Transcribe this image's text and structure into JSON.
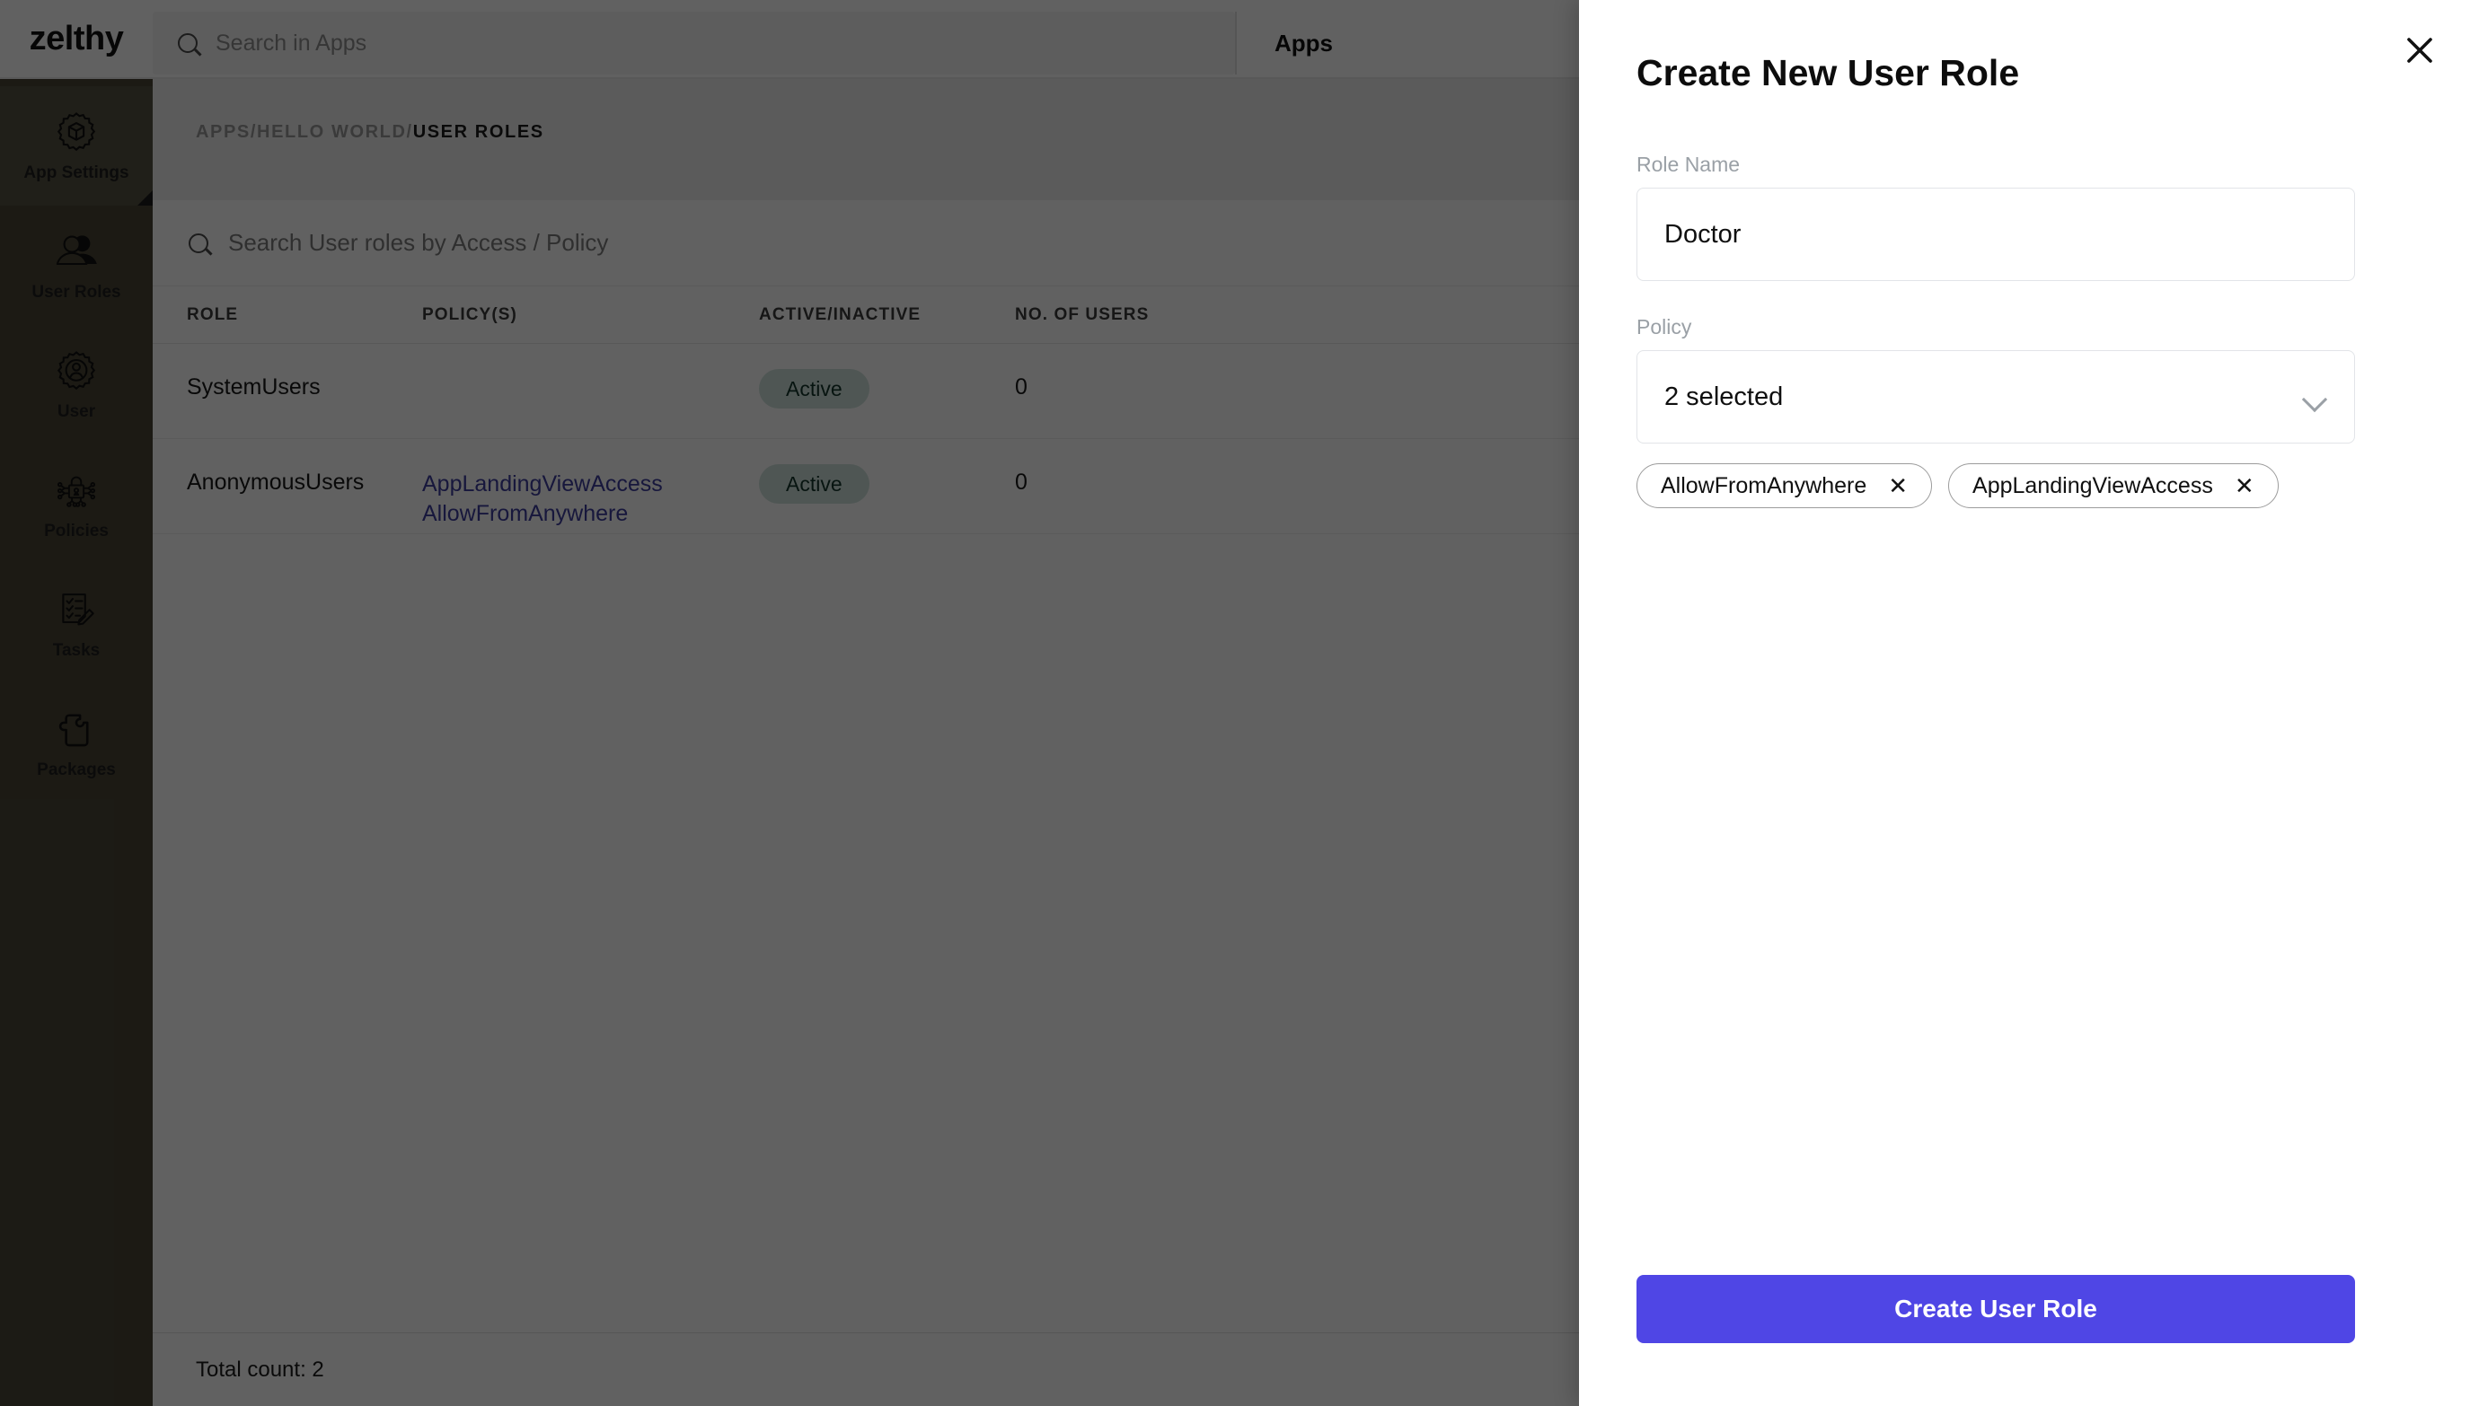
{
  "brand": {
    "logo_text": "zelthy"
  },
  "topbar": {
    "search_placeholder": "Search in Apps",
    "apps_tab_label": "Apps",
    "search_icon": "search-icon"
  },
  "sidebar": {
    "items": [
      {
        "label": "App Settings",
        "icon": "gear-cube-icon",
        "active": true
      },
      {
        "label": "User Roles",
        "icon": "users-group-icon",
        "active": false
      },
      {
        "label": "User",
        "icon": "gear-person-icon",
        "active": false
      },
      {
        "label": "Policies",
        "icon": "lock-network-icon",
        "active": false
      },
      {
        "label": "Tasks",
        "icon": "checklist-pencil-icon",
        "active": false
      },
      {
        "label": "Packages",
        "icon": "puzzle-piece-icon",
        "active": false
      }
    ]
  },
  "breadcrumb": {
    "parts": [
      "APPS",
      "HELLO WORLD"
    ],
    "separator": " / ",
    "current": "USER ROLES"
  },
  "table_search": {
    "placeholder": "Search User roles by Access / Policy",
    "icon": "search-icon"
  },
  "table": {
    "columns": [
      "ROLE",
      "POLICY(S)",
      "ACTIVE/INACTIVE",
      "NO. OF USERS"
    ],
    "rows": [
      {
        "role": "SystemUsers",
        "policies": [],
        "status": "Active",
        "users": "0"
      },
      {
        "role": "AnonymousUsers",
        "policies": [
          "AppLandingViewAccess",
          "AllowFromAnywhere"
        ],
        "status": "Active",
        "users": "0"
      }
    ],
    "footer": "Total count: 2"
  },
  "modal": {
    "title": "Create New User Role",
    "close_icon": "close-icon",
    "role_name": {
      "label": "Role Name",
      "value": "Doctor"
    },
    "policy": {
      "label": "Policy",
      "selected_text": "2 selected",
      "chevron_icon": "chevron-down-icon",
      "chips": [
        {
          "label": "AllowFromAnywhere",
          "remove_icon": "close-icon",
          "remove_glyph": "✕"
        },
        {
          "label": "AppLandingViewAccess",
          "remove_icon": "close-icon",
          "remove_glyph": "✕"
        }
      ]
    },
    "submit_label": "Create User Role"
  },
  "colors": {
    "accent": "#4f46e5",
    "sidebar": "#4a4636",
    "sidebar_active": "#565142",
    "link": "#3d3d9e",
    "badge_bg": "#cfe3dd"
  }
}
